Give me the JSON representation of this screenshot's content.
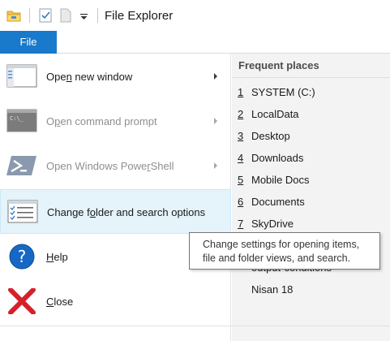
{
  "window": {
    "title": "File Explorer"
  },
  "ribbon": {
    "file_tab": "File"
  },
  "menu": {
    "items": [
      {
        "label": "Open new window",
        "accel": "n",
        "icon": "new-window-icon",
        "disabled": false,
        "has_submenu": true
      },
      {
        "label": "Open command prompt",
        "accel": "p",
        "icon": "command-prompt-icon",
        "disabled": true,
        "has_submenu": true
      },
      {
        "label": "Open Windows PowerShell",
        "accel": "r",
        "icon": "powershell-icon",
        "disabled": true,
        "has_submenu": true
      },
      {
        "label": "Change folder and search options",
        "accel": "o",
        "icon": "folder-options-icon",
        "disabled": false,
        "has_submenu": false
      },
      {
        "label": "Help",
        "accel": "H",
        "icon": "help-icon",
        "disabled": false,
        "has_submenu": false
      },
      {
        "label": "Close",
        "accel": "C",
        "icon": "close-icon",
        "disabled": false,
        "has_submenu": false
      }
    ]
  },
  "frequent_places": {
    "title": "Frequent places",
    "items": [
      {
        "num": "1",
        "name": "SYSTEM (C:)"
      },
      {
        "num": "2",
        "name": "LocalData"
      },
      {
        "num": "3",
        "name": "Desktop"
      },
      {
        "num": "4",
        "name": "Downloads"
      },
      {
        "num": "5",
        "name": "Mobile Docs"
      },
      {
        "num": "6",
        "name": "Documents"
      },
      {
        "num": "7",
        "name": "SkyDrive"
      },
      {
        "num": "",
        "name": ""
      },
      {
        "num": "",
        "name": "output-conditions"
      },
      {
        "num": "",
        "name": "Nisan 18"
      }
    ]
  },
  "tooltip": {
    "line1": "Change settings for opening items,",
    "line2": "file and folder views, and search."
  },
  "colors": {
    "accent": "#1979ca",
    "selected_bg": "#e5f3fb",
    "panel_bg": "#f3f3f3",
    "help_blue": "#1768c5",
    "close_red": "#d6202a"
  }
}
